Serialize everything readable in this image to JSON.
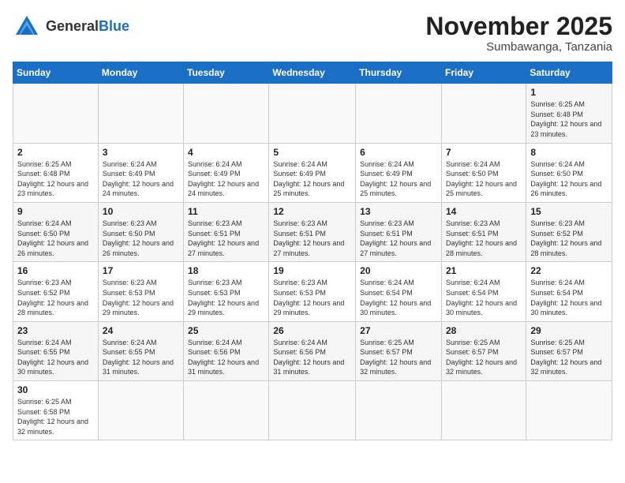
{
  "header": {
    "logo_general": "General",
    "logo_blue": "Blue",
    "month": "November 2025",
    "location": "Sumbawanga, Tanzania"
  },
  "days_of_week": [
    "Sunday",
    "Monday",
    "Tuesday",
    "Wednesday",
    "Thursday",
    "Friday",
    "Saturday"
  ],
  "weeks": [
    [
      {
        "day": "",
        "info": ""
      },
      {
        "day": "",
        "info": ""
      },
      {
        "day": "",
        "info": ""
      },
      {
        "day": "",
        "info": ""
      },
      {
        "day": "",
        "info": ""
      },
      {
        "day": "",
        "info": ""
      },
      {
        "day": "1",
        "info": "Sunrise: 6:25 AM\nSunset: 6:48 PM\nDaylight: 12 hours and 23 minutes."
      }
    ],
    [
      {
        "day": "2",
        "info": "Sunrise: 6:25 AM\nSunset: 6:48 PM\nDaylight: 12 hours and 23 minutes."
      },
      {
        "day": "3",
        "info": "Sunrise: 6:24 AM\nSunset: 6:49 PM\nDaylight: 12 hours and 24 minutes."
      },
      {
        "day": "4",
        "info": "Sunrise: 6:24 AM\nSunset: 6:49 PM\nDaylight: 12 hours and 24 minutes."
      },
      {
        "day": "5",
        "info": "Sunrise: 6:24 AM\nSunset: 6:49 PM\nDaylight: 12 hours and 25 minutes."
      },
      {
        "day": "6",
        "info": "Sunrise: 6:24 AM\nSunset: 6:49 PM\nDaylight: 12 hours and 25 minutes."
      },
      {
        "day": "7",
        "info": "Sunrise: 6:24 AM\nSunset: 6:50 PM\nDaylight: 12 hours and 25 minutes."
      },
      {
        "day": "8",
        "info": "Sunrise: 6:24 AM\nSunset: 6:50 PM\nDaylight: 12 hours and 26 minutes."
      }
    ],
    [
      {
        "day": "9",
        "info": "Sunrise: 6:24 AM\nSunset: 6:50 PM\nDaylight: 12 hours and 26 minutes."
      },
      {
        "day": "10",
        "info": "Sunrise: 6:23 AM\nSunset: 6:50 PM\nDaylight: 12 hours and 26 minutes."
      },
      {
        "day": "11",
        "info": "Sunrise: 6:23 AM\nSunset: 6:51 PM\nDaylight: 12 hours and 27 minutes."
      },
      {
        "day": "12",
        "info": "Sunrise: 6:23 AM\nSunset: 6:51 PM\nDaylight: 12 hours and 27 minutes."
      },
      {
        "day": "13",
        "info": "Sunrise: 6:23 AM\nSunset: 6:51 PM\nDaylight: 12 hours and 27 minutes."
      },
      {
        "day": "14",
        "info": "Sunrise: 6:23 AM\nSunset: 6:51 PM\nDaylight: 12 hours and 28 minutes."
      },
      {
        "day": "15",
        "info": "Sunrise: 6:23 AM\nSunset: 6:52 PM\nDaylight: 12 hours and 28 minutes."
      }
    ],
    [
      {
        "day": "16",
        "info": "Sunrise: 6:23 AM\nSunset: 6:52 PM\nDaylight: 12 hours and 28 minutes."
      },
      {
        "day": "17",
        "info": "Sunrise: 6:23 AM\nSunset: 6:53 PM\nDaylight: 12 hours and 29 minutes."
      },
      {
        "day": "18",
        "info": "Sunrise: 6:23 AM\nSunset: 6:53 PM\nDaylight: 12 hours and 29 minutes."
      },
      {
        "day": "19",
        "info": "Sunrise: 6:23 AM\nSunset: 6:53 PM\nDaylight: 12 hours and 29 minutes."
      },
      {
        "day": "20",
        "info": "Sunrise: 6:24 AM\nSunset: 6:54 PM\nDaylight: 12 hours and 30 minutes."
      },
      {
        "day": "21",
        "info": "Sunrise: 6:24 AM\nSunset: 6:54 PM\nDaylight: 12 hours and 30 minutes."
      },
      {
        "day": "22",
        "info": "Sunrise: 6:24 AM\nSunset: 6:54 PM\nDaylight: 12 hours and 30 minutes."
      }
    ],
    [
      {
        "day": "23",
        "info": "Sunrise: 6:24 AM\nSunset: 6:55 PM\nDaylight: 12 hours and 30 minutes."
      },
      {
        "day": "24",
        "info": "Sunrise: 6:24 AM\nSunset: 6:55 PM\nDaylight: 12 hours and 31 minutes."
      },
      {
        "day": "25",
        "info": "Sunrise: 6:24 AM\nSunset: 6:56 PM\nDaylight: 12 hours and 31 minutes."
      },
      {
        "day": "26",
        "info": "Sunrise: 6:24 AM\nSunset: 6:56 PM\nDaylight: 12 hours and 31 minutes."
      },
      {
        "day": "27",
        "info": "Sunrise: 6:25 AM\nSunset: 6:57 PM\nDaylight: 12 hours and 32 minutes."
      },
      {
        "day": "28",
        "info": "Sunrise: 6:25 AM\nSunset: 6:57 PM\nDaylight: 12 hours and 32 minutes."
      },
      {
        "day": "29",
        "info": "Sunrise: 6:25 AM\nSunset: 6:57 PM\nDaylight: 12 hours and 32 minutes."
      }
    ],
    [
      {
        "day": "30",
        "info": "Sunrise: 6:25 AM\nSunset: 6:58 PM\nDaylight: 12 hours and 32 minutes."
      },
      {
        "day": "",
        "info": ""
      },
      {
        "day": "",
        "info": ""
      },
      {
        "day": "",
        "info": ""
      },
      {
        "day": "",
        "info": ""
      },
      {
        "day": "",
        "info": ""
      },
      {
        "day": "",
        "info": ""
      }
    ]
  ]
}
